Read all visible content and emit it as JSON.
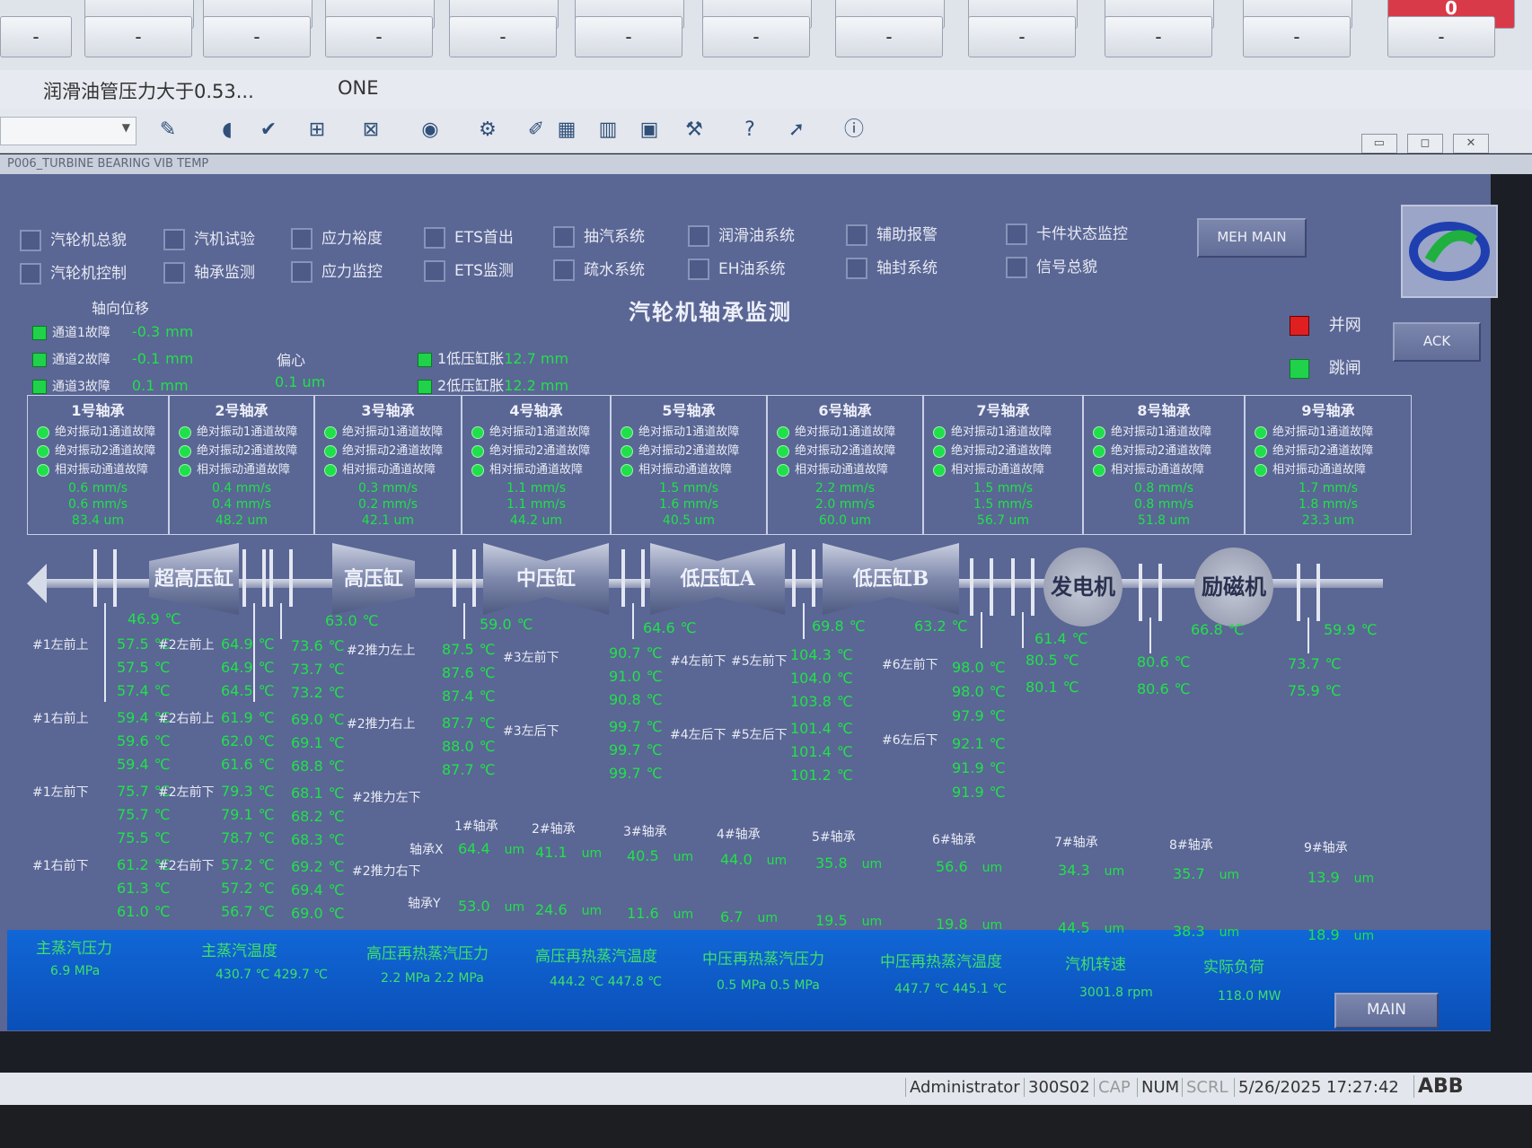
{
  "top": {
    "row1": [
      "",
      "",
      "",
      "",
      "",
      "",
      "",
      "",
      "",
      "",
      "",
      "0"
    ],
    "row2": [
      "-",
      "-",
      "-",
      "-",
      "-",
      "-",
      "-",
      "-",
      "-",
      "-",
      "-",
      "-"
    ],
    "alarm_text": "润滑油管压力大于0.53...",
    "alarm_source": "ONE"
  },
  "toolbar_icons": [
    "edit-icon",
    "speaker-icon",
    "document-check-icon",
    "network-icon",
    "network-x-icon",
    "database-play-icon",
    "settings-doc-icon",
    "edit-doc-icon",
    "calendar-icon",
    "chart-icon",
    "frame-icon",
    "tools-icon",
    "help-icon",
    "pointer-icon",
    "info-icon"
  ],
  "window_title": "P006_TURBINE BEARING VIB TEMP",
  "window_controls": {
    "minimize": "▭",
    "restore": "◻",
    "close": "✕"
  },
  "nav": {
    "row1": [
      "汽轮机总貌",
      "汽机试验",
      "应力裕度",
      "ETS首出",
      "抽汽系统",
      "润滑油系统",
      "辅助报警",
      "卡件状态监控"
    ],
    "row2": [
      "汽轮机控制",
      "轴承监测",
      "应力监控",
      "ETS监测",
      "疏水系统",
      "EH油系统",
      "轴封系统",
      "信号总貌"
    ],
    "meh_main": "MEH MAIN",
    "ack": "ACK",
    "main": "MAIN"
  },
  "title": "汽轮机轴承监测",
  "status": {
    "grid": "并网",
    "trip": "跳闸",
    "grid_color": "#e02020",
    "trip_color": "#20d040"
  },
  "axial": {
    "title": "轴向位移",
    "items": [
      {
        "label": "通道1故障",
        "value": "-0.3",
        "unit": "mm"
      },
      {
        "label": "通道2故障",
        "value": "-0.1",
        "unit": "mm"
      },
      {
        "label": "通道3故障",
        "value": "0.1",
        "unit": "mm"
      }
    ],
    "ecc_label": "偏心",
    "ecc_value": "0.1",
    "ecc_unit": "um",
    "lp1_label": "1低压缸胀",
    "lp1_value": "12.7",
    "lp2_label": "2低压缸胀",
    "lp2_value": "12.2",
    "exp_unit": "mm"
  },
  "bearings": [
    {
      "name": "1号轴承",
      "v1": "0.6 mm/s",
      "v2": "0.6 mm/s",
      "v3": "83.4 um"
    },
    {
      "name": "2号轴承",
      "v1": "0.4 mm/s",
      "v2": "0.4 mm/s",
      "v3": "48.2 um"
    },
    {
      "name": "3号轴承",
      "v1": "0.3 mm/s",
      "v2": "0.2 mm/s",
      "v3": "42.1 um"
    },
    {
      "name": "4号轴承",
      "v1": "1.1 mm/s",
      "v2": "1.1 mm/s",
      "v3": "44.2 um"
    },
    {
      "name": "5号轴承",
      "v1": "1.5 mm/s",
      "v2": "1.6 mm/s",
      "v3": "40.5 um"
    },
    {
      "name": "6号轴承",
      "v1": "2.2 mm/s",
      "v2": "2.0 mm/s",
      "v3": "60.0 um"
    },
    {
      "name": "7号轴承",
      "v1": "1.5 mm/s",
      "v2": "1.5 mm/s",
      "v3": "56.7 um"
    },
    {
      "name": "8号轴承",
      "v1": "0.8 mm/s",
      "v2": "0.8 mm/s",
      "v3": "51.8 um"
    },
    {
      "name": "9号轴承",
      "v1": "1.7 mm/s",
      "v2": "1.8 mm/s",
      "v3": "23.3 um"
    }
  ],
  "bearing_faults": [
    "绝对振动1通道故障",
    "绝对振动2通道故障",
    "相对振动通道故障"
  ],
  "machines": {
    "shp": "超高压缸",
    "hp": "高压缸",
    "ip": "中压缸",
    "lpa": "低压缸A",
    "lpb": "低压缸B",
    "gen": "发电机",
    "exc": "励磁机"
  },
  "shaft_temps": [
    "46.9",
    "63.0",
    "59.0",
    "64.6",
    "69.8",
    "63.2",
    "61.4",
    "66.8",
    "59.9"
  ],
  "temp_unit": "℃",
  "temps": {
    "c1_labels": [
      "#1左前上",
      "#1右前上",
      "#1左前下",
      "#1右前下"
    ],
    "c1": [
      [
        "57.5",
        "57.5",
        "57.4"
      ],
      [
        "59.4",
        "59.6",
        "59.4"
      ],
      [
        "75.7",
        "75.7",
        "75.5"
      ],
      [
        "61.2",
        "61.3",
        "61.0"
      ]
    ],
    "c2_labels": [
      "#2左前上",
      "#2右前上",
      "#2左前下",
      "#2右前下"
    ],
    "c2": [
      [
        "64.9",
        "64.9",
        "64.5"
      ],
      [
        "61.9",
        "62.0",
        "61.6"
      ],
      [
        "79.3",
        "79.1",
        "78.7"
      ],
      [
        "57.2",
        "57.2",
        "56.7"
      ]
    ],
    "c3_labels": [
      "#2推力左上",
      "#2推力右上",
      "#2推力左下",
      "#2推力右下"
    ],
    "c3": [
      [
        "73.6",
        "73.7",
        "73.2"
      ],
      [
        "69.0",
        "69.1",
        "68.8"
      ],
      [
        "68.1",
        "68.2",
        "68.3"
      ],
      [
        "69.2",
        "69.4",
        "69.0"
      ]
    ],
    "c4": [
      "87.5",
      "87.6",
      "87.4",
      "87.7",
      "88.0",
      "87.7"
    ],
    "c4_labels": [
      "#3左前下",
      "#3左后下"
    ],
    "c5": [
      "90.7",
      "91.0",
      "90.8",
      "99.7",
      "99.7",
      "99.7"
    ],
    "c5_labels": [
      "#4左前下",
      "#4左后下"
    ],
    "c6_labels": [
      "#5左前下",
      "#5左后下"
    ],
    "c6": [
      "104.3",
      "104.0",
      "103.8",
      "101.4",
      "101.4",
      "101.2"
    ],
    "c7_labels": [
      "#6左前下",
      "#6左后下"
    ],
    "c7": [
      "98.0",
      "98.0",
      "97.9",
      "92.1",
      "91.9",
      "91.9"
    ],
    "c8": [
      "80.5",
      "80.1"
    ],
    "c9": [
      "80.6",
      "80.6"
    ],
    "c10": [
      "73.7",
      "75.9"
    ]
  },
  "shaft_vib": {
    "x_label": "轴承X",
    "y_label": "轴承Y",
    "unit": "um",
    "names": [
      "1#轴承",
      "2#轴承",
      "3#轴承",
      "4#轴承",
      "5#轴承",
      "6#轴承",
      "7#轴承",
      "8#轴承",
      "9#轴承"
    ],
    "x": [
      "64.4",
      "41.1",
      "40.5",
      "44.0",
      "35.8",
      "56.6",
      "34.3",
      "35.7",
      "13.9"
    ],
    "y": [
      "53.0",
      "24.6",
      "11.6",
      "6.7",
      "19.5",
      "19.8",
      "44.5",
      "38.3",
      "18.9"
    ]
  },
  "bottom": [
    {
      "label": "主蒸汽压力",
      "values": "6.9 MPa"
    },
    {
      "label": "主蒸汽温度",
      "values": "430.7 ℃  429.7 ℃"
    },
    {
      "label": "高压再热蒸汽压力",
      "values": "2.2 MPa    2.2 MPa"
    },
    {
      "label": "高压再热蒸汽温度",
      "values": "444.2 ℃  447.8 ℃"
    },
    {
      "label": "中压再热蒸汽压力",
      "values": "0.5 MPa    0.5 MPa"
    },
    {
      "label": "中压再热蒸汽温度",
      "values": "447.7 ℃  445.1 ℃"
    },
    {
      "label": "汽机转速",
      "values": "3001.8 rpm"
    },
    {
      "label": "实际负荷",
      "values": "118.0 MW"
    }
  ],
  "statusbar": {
    "user": "Administrator",
    "station": "300S02",
    "cap": "CAP",
    "num": "NUM",
    "scrl": "SCRL",
    "datetime": "5/26/2025 17:27:42",
    "brand": "ABB"
  }
}
